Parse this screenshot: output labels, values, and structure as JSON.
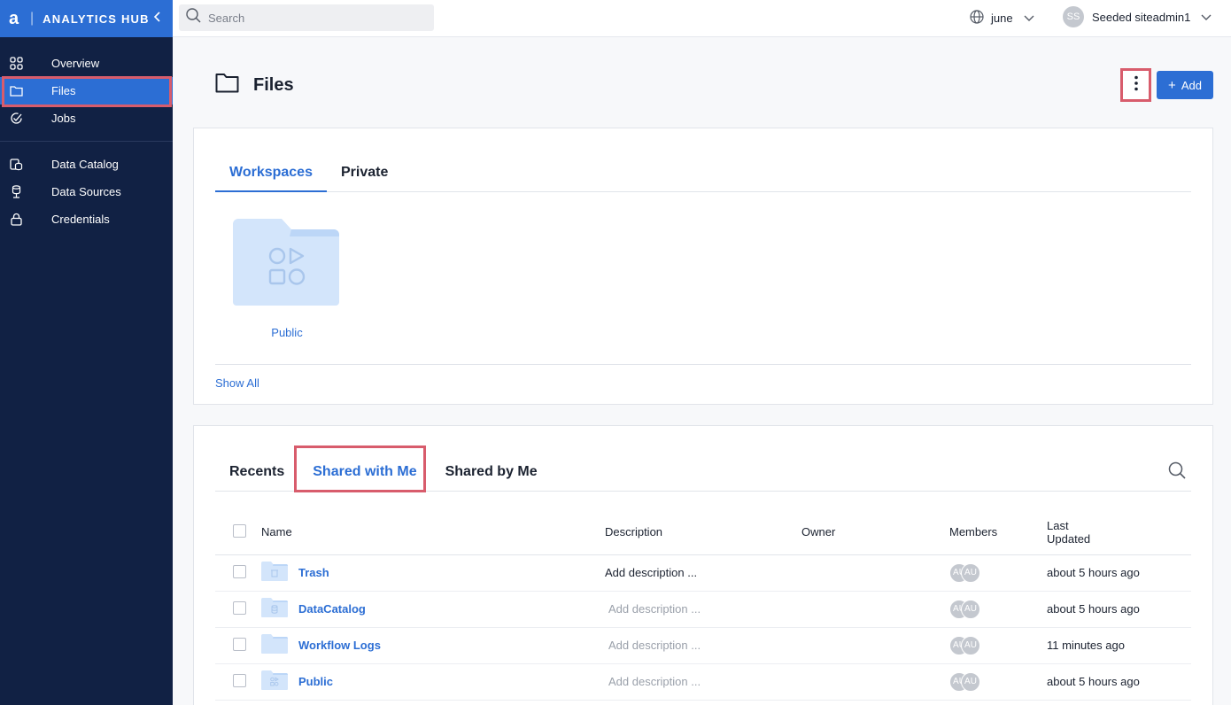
{
  "brand": {
    "logo": "a",
    "name": "ANALYTICS HUB"
  },
  "sidebar": {
    "items": [
      {
        "label": "Overview",
        "icon": "grid-icon"
      },
      {
        "label": "Files",
        "icon": "folder-icon"
      },
      {
        "label": "Jobs",
        "icon": "check-circle-icon"
      },
      {
        "label": "Data Catalog",
        "icon": "catalog-icon"
      },
      {
        "label": "Data Sources",
        "icon": "data-source-icon"
      },
      {
        "label": "Credentials",
        "icon": "lock-icon"
      }
    ]
  },
  "topbar": {
    "search_placeholder": "Search",
    "workspace": "june",
    "user_initials": "SS",
    "user_name": "Seeded siteadmin1"
  },
  "page": {
    "title": "Files",
    "add_label": "Add"
  },
  "workspaces": {
    "tabs": [
      "Workspaces",
      "Private"
    ],
    "folders": [
      {
        "label": "Public"
      }
    ],
    "show_all": "Show All"
  },
  "files": {
    "tabs": [
      "Recents",
      "Shared with Me",
      "Shared by Me"
    ],
    "columns": {
      "name": "Name",
      "description": "Description",
      "owner": "Owner",
      "members": "Members",
      "last_updated_1": "Last",
      "last_updated_2": "Updated"
    },
    "rows": [
      {
        "name": "Trash",
        "description": "Add description ...",
        "owner": "",
        "members": [
          "AU",
          "AU"
        ],
        "updated": "about 5 hours ago"
      },
      {
        "name": "DataCatalog",
        "description": "Add description ...",
        "owner": "",
        "members": [
          "AU",
          "AU"
        ],
        "updated": "about 5 hours ago"
      },
      {
        "name": "Workflow Logs",
        "description": "Add description ...",
        "owner": "",
        "members": [
          "AU",
          "AU"
        ],
        "updated": "11 minutes ago"
      },
      {
        "name": "Public",
        "description": "Add description ...",
        "owner": "",
        "members": [
          "AU",
          "AU"
        ],
        "updated": "about 5 hours ago"
      }
    ]
  },
  "colors": {
    "accent": "#2c6ed4",
    "sidebar": "#112144",
    "highlight": "#d85c6c",
    "folder": "#d3e5fb"
  }
}
